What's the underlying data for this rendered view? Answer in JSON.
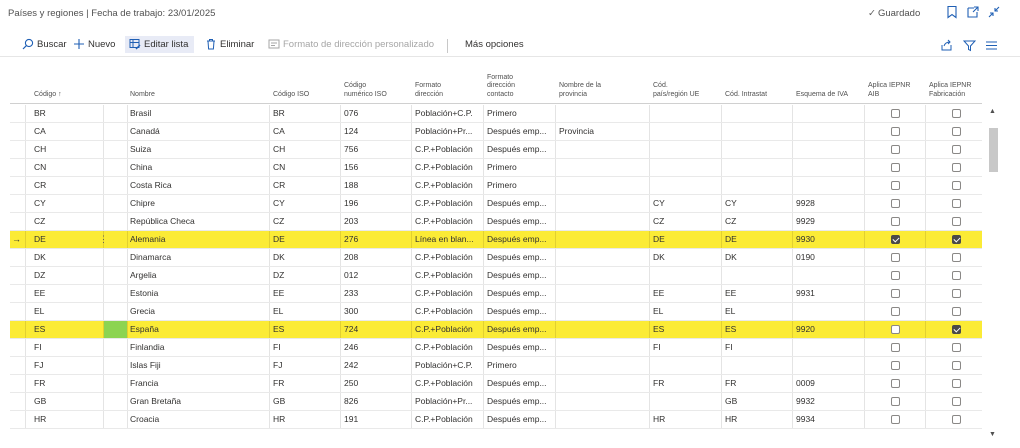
{
  "window": {
    "title": "Países y regiones | Fecha de trabajo: 23/01/2025",
    "saved_label": "Guardado",
    "icons": [
      "bookmark-icon",
      "open-in-new-icon",
      "collapse-icon"
    ]
  },
  "toolbar": {
    "search": "Buscar",
    "new": "Nuevo",
    "edit_list": "Editar lista",
    "delete": "Eliminar",
    "address_format": "Formato de dirección personalizado",
    "more": "Más opciones",
    "right_icons": [
      "share-icon",
      "filter-icon",
      "list-view-icon"
    ]
  },
  "columns": {
    "code": "Código ↑",
    "name": "Nombre",
    "iso": "Código ISO",
    "iso_num": [
      "Código",
      "numérico ISO"
    ],
    "addr_fmt": [
      "Formato",
      "dirección"
    ],
    "contact_fmt": [
      "Formato",
      "dirección",
      "contacto"
    ],
    "county": [
      "Nombre de la",
      "provincia"
    ],
    "eu_code": [
      "Cód.",
      "país/región UE"
    ],
    "intrastat": "Cód. Intrastat",
    "vat_scheme": "Esquema de IVA",
    "iepnr_aib": [
      "Aplica IEPNR",
      "AIB"
    ],
    "iepnr_fab": [
      "Aplica IEPNR",
      "Fabricación"
    ]
  },
  "rows": [
    {
      "code": "BR",
      "name": "Brasil",
      "iso": "BR",
      "num": "076",
      "addr": "Población+C.P.",
      "contact": "Primero",
      "county": "",
      "eu": "",
      "intrastat": "",
      "vat": "",
      "aib": false,
      "fab": false
    },
    {
      "code": "CA",
      "name": "Canadá",
      "iso": "CA",
      "num": "124",
      "addr": "Población+Pr...",
      "contact": "Después emp...",
      "county": "Provincia",
      "eu": "",
      "intrastat": "",
      "vat": "",
      "aib": false,
      "fab": false
    },
    {
      "code": "CH",
      "name": "Suiza",
      "iso": "CH",
      "num": "756",
      "addr": "C.P.+Población",
      "contact": "Después emp...",
      "county": "",
      "eu": "",
      "intrastat": "",
      "vat": "",
      "aib": false,
      "fab": false
    },
    {
      "code": "CN",
      "name": "China",
      "iso": "CN",
      "num": "156",
      "addr": "C.P.+Población",
      "contact": "Primero",
      "county": "",
      "eu": "",
      "intrastat": "",
      "vat": "",
      "aib": false,
      "fab": false
    },
    {
      "code": "CR",
      "name": "Costa Rica",
      "iso": "CR",
      "num": "188",
      "addr": "C.P.+Población",
      "contact": "Primero",
      "county": "",
      "eu": "",
      "intrastat": "",
      "vat": "",
      "aib": false,
      "fab": false
    },
    {
      "code": "CY",
      "name": "Chipre",
      "iso": "CY",
      "num": "196",
      "addr": "C.P.+Población",
      "contact": "Después emp...",
      "county": "",
      "eu": "CY",
      "intrastat": "CY",
      "vat": "9928",
      "aib": false,
      "fab": false
    },
    {
      "code": "CZ",
      "name": "República Checa",
      "iso": "CZ",
      "num": "203",
      "addr": "C.P.+Población",
      "contact": "Después emp...",
      "county": "",
      "eu": "CZ",
      "intrastat": "CZ",
      "vat": "9929",
      "aib": false,
      "fab": false
    },
    {
      "code": "DE",
      "name": "Alemania",
      "iso": "DE",
      "num": "276",
      "addr": "Línea en blan...",
      "contact": "Después emp...",
      "county": "",
      "eu": "DE",
      "intrastat": "DE",
      "vat": "9930",
      "aib": true,
      "fab": true,
      "highlight": true,
      "current": true
    },
    {
      "code": "DK",
      "name": "Dinamarca",
      "iso": "DK",
      "num": "208",
      "addr": "C.P.+Población",
      "contact": "Después emp...",
      "county": "",
      "eu": "DK",
      "intrastat": "DK",
      "vat": "0190",
      "aib": false,
      "fab": false
    },
    {
      "code": "DZ",
      "name": "Argelia",
      "iso": "DZ",
      "num": "012",
      "addr": "C.P.+Población",
      "contact": "Después emp...",
      "county": "",
      "eu": "",
      "intrastat": "",
      "vat": "",
      "aib": false,
      "fab": false
    },
    {
      "code": "EE",
      "name": "Estonia",
      "iso": "EE",
      "num": "233",
      "addr": "C.P.+Población",
      "contact": "Después emp...",
      "county": "",
      "eu": "EE",
      "intrastat": "EE",
      "vat": "9931",
      "aib": false,
      "fab": false
    },
    {
      "code": "EL",
      "name": "Grecia",
      "iso": "EL",
      "num": "300",
      "addr": "C.P.+Población",
      "contact": "Después emp...",
      "county": "",
      "eu": "EL",
      "intrastat": "EL",
      "vat": "",
      "aib": false,
      "fab": false
    },
    {
      "code": "ES",
      "name": "España",
      "iso": "ES",
      "num": "724",
      "addr": "C.P.+Población",
      "contact": "Después emp...",
      "county": "",
      "eu": "ES",
      "intrastat": "ES",
      "vat": "9920",
      "aib": false,
      "fab": true,
      "highlight": true,
      "green": true
    },
    {
      "code": "FI",
      "name": "Finlandia",
      "iso": "FI",
      "num": "246",
      "addr": "C.P.+Población",
      "contact": "Después emp...",
      "county": "",
      "eu": "FI",
      "intrastat": "FI",
      "vat": "",
      "aib": false,
      "fab": false
    },
    {
      "code": "FJ",
      "name": "Islas Fiji",
      "iso": "FJ",
      "num": "242",
      "addr": "Población+C.P.",
      "contact": "Primero",
      "county": "",
      "eu": "",
      "intrastat": "",
      "vat": "",
      "aib": false,
      "fab": false
    },
    {
      "code": "FR",
      "name": "Francia",
      "iso": "FR",
      "num": "250",
      "addr": "C.P.+Población",
      "contact": "Después emp...",
      "county": "",
      "eu": "FR",
      "intrastat": "FR",
      "vat": "0009",
      "aib": false,
      "fab": false
    },
    {
      "code": "GB",
      "name": "Gran Bretaña",
      "iso": "GB",
      "num": "826",
      "addr": "Población+Pr...",
      "contact": "Después emp...",
      "county": "",
      "eu": "",
      "intrastat": "GB",
      "vat": "9932",
      "aib": false,
      "fab": false
    },
    {
      "code": "HR",
      "name": "Croacia",
      "iso": "HR",
      "num": "191",
      "addr": "C.P.+Población",
      "contact": "Después emp...",
      "county": "",
      "eu": "HR",
      "intrastat": "HR",
      "vat": "9934",
      "aib": false,
      "fab": false
    }
  ]
}
